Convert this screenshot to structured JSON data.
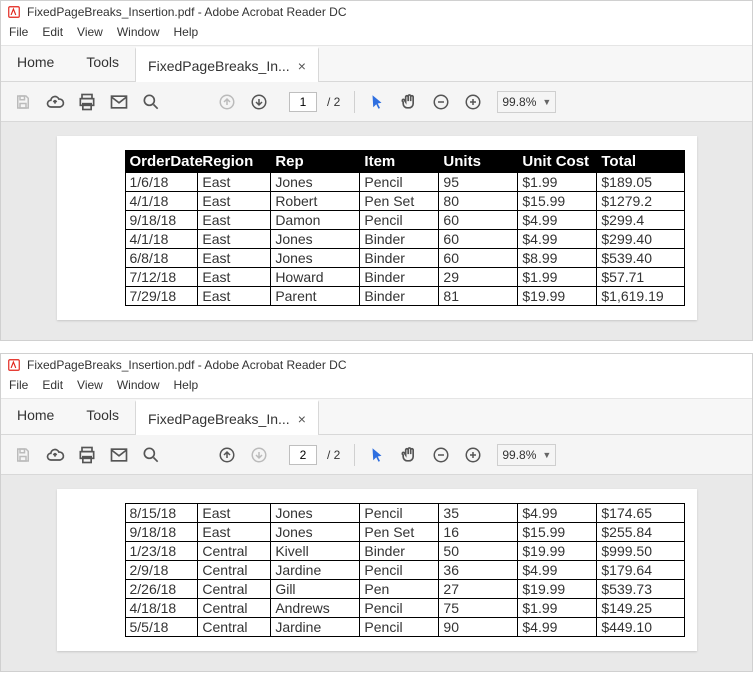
{
  "app": {
    "title": "FixedPageBreaks_Insertion.pdf - Adobe Acrobat Reader DC",
    "menus": [
      "File",
      "Edit",
      "View",
      "Window",
      "Help"
    ],
    "tabs": {
      "home": "Home",
      "tools": "Tools",
      "doc": "FixedPageBreaks_In..."
    },
    "zoom": "99.8%",
    "total_pages": "/ 2"
  },
  "windows": [
    {
      "current_page": "1",
      "up_disabled": true,
      "down_disabled": false
    },
    {
      "current_page": "2",
      "up_disabled": false,
      "down_disabled": true
    }
  ],
  "table": {
    "headers": [
      "OrderDate",
      "Region",
      "Rep",
      "Item",
      "Units",
      "Unit Cost",
      "Total"
    ]
  },
  "chart_data": [
    {
      "type": "table",
      "title": "Page 1",
      "columns": [
        "OrderDate",
        "Region",
        "Rep",
        "Item",
        "Units",
        "Unit Cost",
        "Total"
      ],
      "rows": [
        [
          "1/6/18",
          "East",
          "Jones",
          "Pencil",
          "95",
          "$1.99",
          "$189.05"
        ],
        [
          "4/1/18",
          "East",
          "Robert",
          "Pen Set",
          "80",
          "$15.99",
          "$1279.2"
        ],
        [
          "9/18/18",
          "East",
          "Damon",
          "Pencil",
          "60",
          "$4.99",
          "$299.4"
        ],
        [
          "4/1/18",
          "East",
          "Jones",
          "Binder",
          "60",
          "$4.99",
          "$299.40"
        ],
        [
          "6/8/18",
          "East",
          "Jones",
          "Binder",
          "60",
          "$8.99",
          "$539.40"
        ],
        [
          "7/12/18",
          "East",
          "Howard",
          "Binder",
          "29",
          "$1.99",
          "$57.71"
        ],
        [
          "7/29/18",
          "East",
          "Parent",
          "Binder",
          "81",
          "$19.99",
          "$1,619.19"
        ]
      ]
    },
    {
      "type": "table",
      "title": "Page 2",
      "columns": [
        "OrderDate",
        "Region",
        "Rep",
        "Item",
        "Units",
        "Unit Cost",
        "Total"
      ],
      "rows": [
        [
          "8/15/18",
          "East",
          "Jones",
          "Pencil",
          "35",
          "$4.99",
          "$174.65"
        ],
        [
          "9/18/18",
          "East",
          "Jones",
          "Pen Set",
          "16",
          "$15.99",
          "$255.84"
        ],
        [
          "1/23/18",
          "Central",
          "Kivell",
          "Binder",
          "50",
          "$19.99",
          "$999.50"
        ],
        [
          "2/9/18",
          "Central",
          "Jardine",
          "Pencil",
          "36",
          "$4.99",
          "$179.64"
        ],
        [
          "2/26/18",
          "Central",
          "Gill",
          "Pen",
          "27",
          "$19.99",
          "$539.73"
        ],
        [
          "4/18/18",
          "Central",
          "Andrews",
          "Pencil",
          "75",
          "$1.99",
          "$149.25"
        ],
        [
          "5/5/18",
          "Central",
          "Jardine",
          "Pencil",
          "90",
          "$4.99",
          "$449.10"
        ]
      ]
    }
  ]
}
